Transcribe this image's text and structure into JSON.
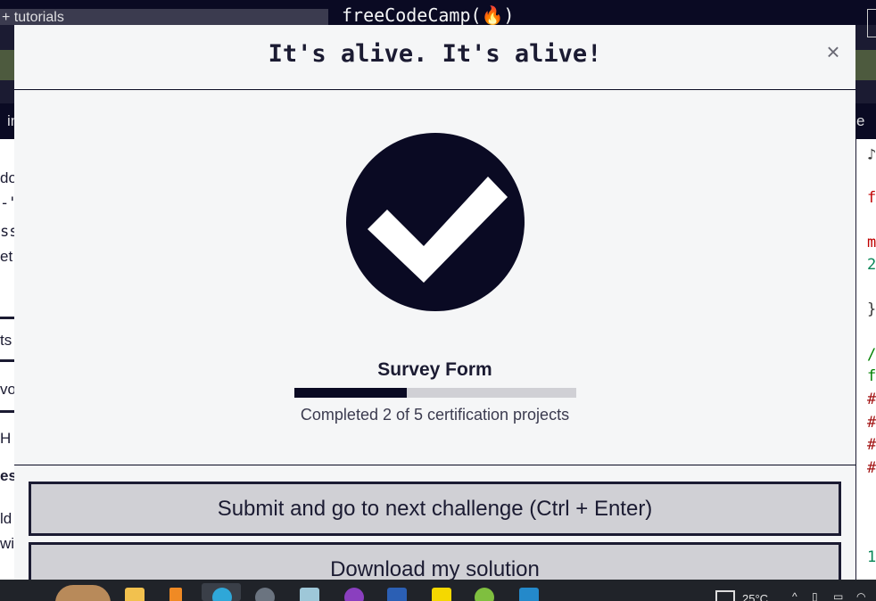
{
  "background": {
    "search_text": "+ tutorials",
    "brand": "freeCodeCamp(🔥)",
    "left_fragments": [
      "in",
      "do",
      "-\"",
      "ss",
      "et",
      "ts",
      "vo",
      "H",
      "es",
      "ld",
      "wi"
    ],
    "right_tab_fragment": "e",
    "code_fragments": [
      "♪",
      "f",
      "m",
      "2",
      "}",
      "/",
      "f",
      "#",
      "#",
      "#",
      "#",
      "1"
    ]
  },
  "modal": {
    "title": "It's alive. It's alive!",
    "close_label": "×",
    "icon": "checkmark-circle-icon",
    "project_title": "Survey Form",
    "progress": {
      "completed": 2,
      "total": 5,
      "fraction": 0.4
    },
    "progress_text": "Completed 2 of 5 certification projects",
    "submit_label": "Submit and go to next challenge (Ctrl + Enter)",
    "download_label": "Download my solution"
  },
  "taskbar": {
    "apps": [
      "folder-icon",
      "vlc-icon",
      "edge-icon",
      "settings-icon",
      "notepad-icon",
      "podcast-icon",
      "word-icon",
      "sticky-notes-icon",
      "android-icon",
      "vscode-icon"
    ],
    "temperature": "25°C"
  },
  "colors": {
    "primary": "#0a0a23",
    "modal_bg": "#f5f6f7",
    "button_bg": "#d0d0d5",
    "progress_track": "#d0d0d5"
  }
}
